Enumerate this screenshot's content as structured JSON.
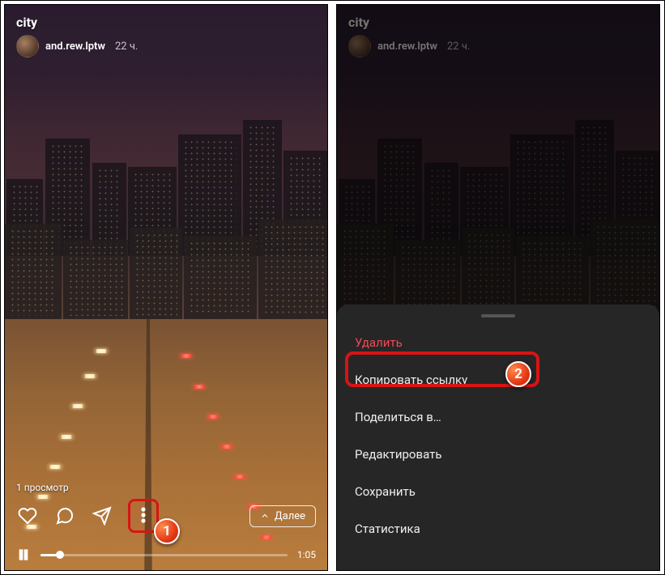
{
  "title": "city",
  "username": "and.rew.lptw",
  "timestamp": "22 ч.",
  "views_label": "1 просмотр",
  "next_label": "Далее",
  "duration": "1:05",
  "badges": {
    "one": "1",
    "two": "2"
  },
  "sheet": {
    "delete": "Удалить",
    "copy_link": "Копировать ссылку",
    "share": "Поделиться в…",
    "edit": "Редактировать",
    "save": "Сохранить",
    "stats": "Статистика"
  }
}
